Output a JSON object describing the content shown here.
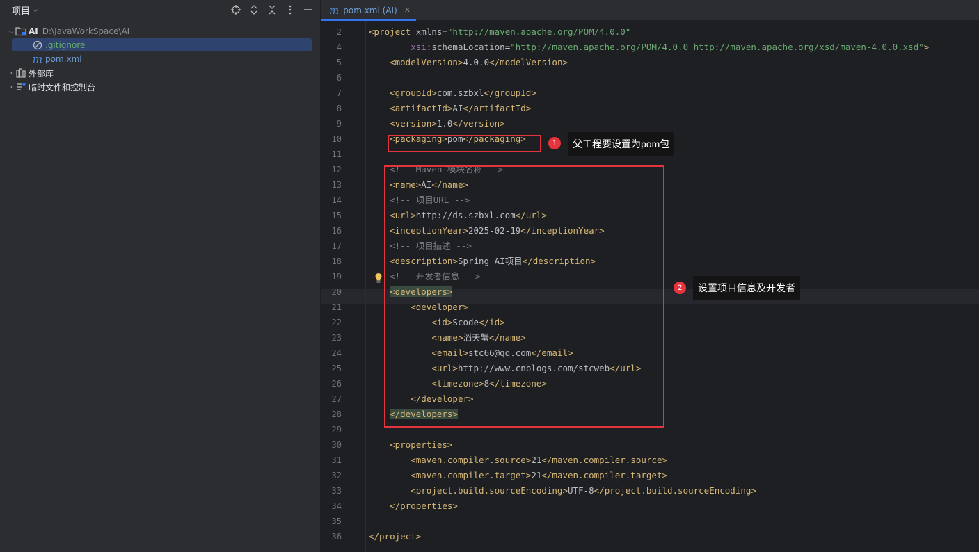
{
  "panel": {
    "title": "项目",
    "tree": [
      {
        "name": "AI",
        "path": "D:\\JavaWorkSpace\\AI"
      },
      {
        "name": ".gitignore"
      },
      {
        "name": "pom.xml"
      },
      {
        "name": "外部库"
      },
      {
        "name": "临时文件和控制台"
      }
    ]
  },
  "tab": {
    "label": "pom.xml (AI)"
  },
  "code_lines": [
    {
      "n": "2",
      "parts": [
        [
          "tag",
          "<project "
        ],
        [
          "attr",
          "xmlns"
        ],
        [
          "txt",
          "="
        ],
        [
          "val",
          "\"http://maven.apache.org/POM/4.0.0\""
        ]
      ]
    },
    {
      "n": "4",
      "parts": [
        [
          "txt",
          "        "
        ],
        [
          "ns",
          "xsi"
        ],
        [
          "attr",
          ":schemaLocation"
        ],
        [
          "txt",
          "="
        ],
        [
          "val",
          "\"http://maven.apache.org/POM/4.0.0 http://maven.apache.org/xsd/maven-4.0.0.xsd\""
        ],
        [
          "tag",
          ">"
        ]
      ]
    },
    {
      "n": "5",
      "parts": [
        [
          "txt",
          "    "
        ],
        [
          "tag",
          "<modelVersion>"
        ],
        [
          "txt",
          "4.0.0"
        ],
        [
          "tag",
          "</modelVersion>"
        ]
      ]
    },
    {
      "n": "6",
      "parts": []
    },
    {
      "n": "7",
      "parts": [
        [
          "txt",
          "    "
        ],
        [
          "tag",
          "<groupId>"
        ],
        [
          "txt",
          "com.szbxl"
        ],
        [
          "tag",
          "</groupId>"
        ]
      ]
    },
    {
      "n": "8",
      "parts": [
        [
          "txt",
          "    "
        ],
        [
          "tag",
          "<artifactId>"
        ],
        [
          "txt",
          "AI"
        ],
        [
          "tag",
          "</artifactId>"
        ]
      ]
    },
    {
      "n": "9",
      "parts": [
        [
          "txt",
          "    "
        ],
        [
          "tag",
          "<version>"
        ],
        [
          "txt",
          "1.0"
        ],
        [
          "tag",
          "</version>"
        ]
      ]
    },
    {
      "n": "10",
      "parts": [
        [
          "txt",
          "    "
        ],
        [
          "tag",
          "<packaging>"
        ],
        [
          "txt",
          "pom"
        ],
        [
          "tag",
          "</packaging>"
        ]
      ]
    },
    {
      "n": "11",
      "parts": []
    },
    {
      "n": "12",
      "parts": [
        [
          "txt",
          "    "
        ],
        [
          "cmt",
          "<!-- Maven 模块名称 -->"
        ]
      ]
    },
    {
      "n": "13",
      "parts": [
        [
          "txt",
          "    "
        ],
        [
          "tag",
          "<name>"
        ],
        [
          "txt",
          "AI"
        ],
        [
          "tag",
          "</name>"
        ]
      ]
    },
    {
      "n": "14",
      "parts": [
        [
          "txt",
          "    "
        ],
        [
          "cmt",
          "<!-- 项目URL -->"
        ]
      ]
    },
    {
      "n": "15",
      "parts": [
        [
          "txt",
          "    "
        ],
        [
          "tag",
          "<url>"
        ],
        [
          "txt",
          "http://ds.szbxl.com"
        ],
        [
          "tag",
          "</url>"
        ]
      ]
    },
    {
      "n": "16",
      "parts": [
        [
          "txt",
          "    "
        ],
        [
          "tag",
          "<inceptionYear>"
        ],
        [
          "txt",
          "2025-02-19"
        ],
        [
          "tag",
          "</inceptionYear>"
        ]
      ]
    },
    {
      "n": "17",
      "parts": [
        [
          "txt",
          "    "
        ],
        [
          "cmt",
          "<!-- 项目描述 -->"
        ]
      ]
    },
    {
      "n": "18",
      "parts": [
        [
          "txt",
          "    "
        ],
        [
          "tag",
          "<description>"
        ],
        [
          "txt",
          "Spring AI项目"
        ],
        [
          "tag",
          "</description>"
        ]
      ]
    },
    {
      "n": "19",
      "parts": [
        [
          "txt",
          "    "
        ],
        [
          "cmt",
          "<!-- 开发者信息 -->"
        ]
      ]
    },
    {
      "n": "20",
      "parts": [
        [
          "txt",
          "    "
        ],
        [
          "tag hl",
          "<developers>"
        ]
      ]
    },
    {
      "n": "21",
      "parts": [
        [
          "txt",
          "        "
        ],
        [
          "tag",
          "<developer>"
        ]
      ]
    },
    {
      "n": "22",
      "parts": [
        [
          "txt",
          "            "
        ],
        [
          "tag",
          "<id>"
        ],
        [
          "txt",
          "Scode"
        ],
        [
          "tag",
          "</id>"
        ]
      ]
    },
    {
      "n": "23",
      "parts": [
        [
          "txt",
          "            "
        ],
        [
          "tag",
          "<name>"
        ],
        [
          "txt",
          "滔天蟹"
        ],
        [
          "tag",
          "</name>"
        ]
      ]
    },
    {
      "n": "24",
      "parts": [
        [
          "txt",
          "            "
        ],
        [
          "tag",
          "<email>"
        ],
        [
          "txt",
          "stc66@qq.com"
        ],
        [
          "tag",
          "</email>"
        ]
      ]
    },
    {
      "n": "25",
      "parts": [
        [
          "txt",
          "            "
        ],
        [
          "tag",
          "<url>"
        ],
        [
          "txt",
          "http://www.cnblogs.com/stcweb"
        ],
        [
          "tag",
          "</url>"
        ]
      ]
    },
    {
      "n": "26",
      "parts": [
        [
          "txt",
          "            "
        ],
        [
          "tag",
          "<timezone>"
        ],
        [
          "txt",
          "8"
        ],
        [
          "tag",
          "</timezone>"
        ]
      ]
    },
    {
      "n": "27",
      "parts": [
        [
          "txt",
          "        "
        ],
        [
          "tag",
          "</developer>"
        ]
      ]
    },
    {
      "n": "28",
      "parts": [
        [
          "txt",
          "    "
        ],
        [
          "tag hl",
          "</developers>"
        ]
      ]
    },
    {
      "n": "29",
      "parts": []
    },
    {
      "n": "30",
      "parts": [
        [
          "txt",
          "    "
        ],
        [
          "tag",
          "<properties>"
        ]
      ]
    },
    {
      "n": "31",
      "parts": [
        [
          "txt",
          "        "
        ],
        [
          "tag",
          "<maven.compiler.source>"
        ],
        [
          "txt",
          "21"
        ],
        [
          "tag",
          "</maven.compiler.source>"
        ]
      ]
    },
    {
      "n": "32",
      "parts": [
        [
          "txt",
          "        "
        ],
        [
          "tag",
          "<maven.compiler.target>"
        ],
        [
          "txt",
          "21"
        ],
        [
          "tag",
          "</maven.compiler.target>"
        ]
      ]
    },
    {
      "n": "33",
      "parts": [
        [
          "txt",
          "        "
        ],
        [
          "tag",
          "<project.build.sourceEncoding>"
        ],
        [
          "txt",
          "UTF-8"
        ],
        [
          "tag",
          "</project.build.sourceEncoding>"
        ]
      ]
    },
    {
      "n": "34",
      "parts": [
        [
          "txt",
          "    "
        ],
        [
          "tag",
          "</properties>"
        ]
      ]
    },
    {
      "n": "35",
      "parts": []
    },
    {
      "n": "36",
      "parts": [
        [
          "tag",
          "</project>"
        ]
      ]
    }
  ],
  "annotations": [
    {
      "badge": "1",
      "text": "父工程要设置为pom包"
    },
    {
      "badge": "2",
      "text": "设置项目信息及开发者"
    }
  ],
  "colors": {
    "accent": "#3574f0",
    "annotation": "#e5343e",
    "tag": "#d5b778",
    "string": "#6aab73"
  }
}
